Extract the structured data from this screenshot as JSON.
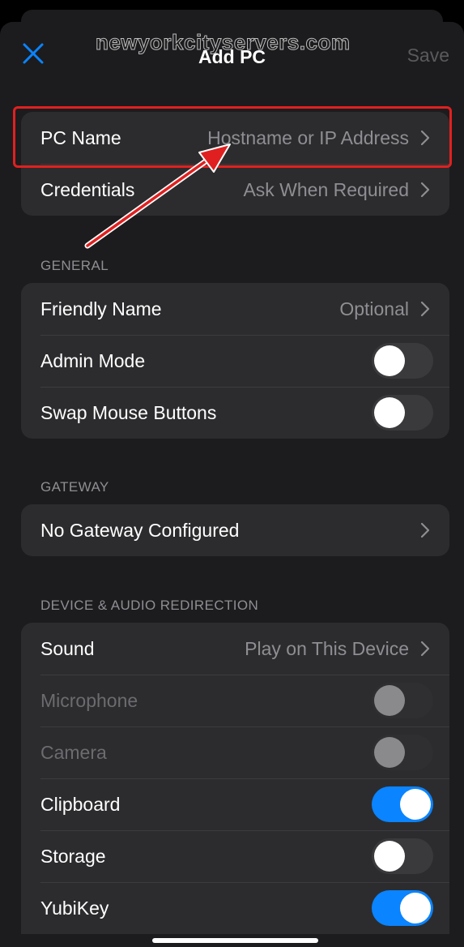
{
  "nav": {
    "title": "Add PC",
    "save_label": "Save",
    "close_icon": "close-icon",
    "watermark": "newyorkcityservers.com"
  },
  "colors": {
    "accent": "#0a84ff",
    "highlight": "#e02020",
    "background": "#1c1c1e",
    "group": "#2c2c2e"
  },
  "connection": {
    "pc_name": {
      "label": "PC Name",
      "value": "Hostname or IP Address"
    },
    "credentials": {
      "label": "Credentials",
      "value": "Ask When Required"
    }
  },
  "general": {
    "header": "GENERAL",
    "friendly_name": {
      "label": "Friendly Name",
      "value": "Optional"
    },
    "admin_mode": {
      "label": "Admin Mode",
      "on": false
    },
    "swap_mouse": {
      "label": "Swap Mouse Buttons",
      "on": false
    }
  },
  "gateway": {
    "header": "GATEWAY",
    "item": {
      "label": "No Gateway Configured"
    }
  },
  "redirection": {
    "header": "DEVICE & AUDIO REDIRECTION",
    "sound": {
      "label": "Sound",
      "value": "Play on This Device"
    },
    "microphone": {
      "label": "Microphone",
      "on": false,
      "enabled": false
    },
    "camera": {
      "label": "Camera",
      "on": false,
      "enabled": false
    },
    "clipboard": {
      "label": "Clipboard",
      "on": true
    },
    "storage": {
      "label": "Storage",
      "on": false
    },
    "yubikey": {
      "label": "YubiKey",
      "on": true
    }
  }
}
